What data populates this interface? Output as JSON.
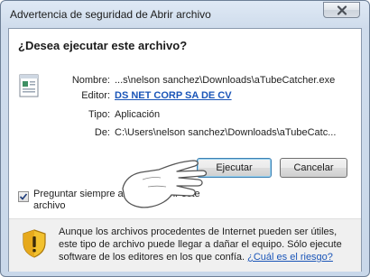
{
  "window": {
    "title": "Advertencia de seguridad de Abrir archivo"
  },
  "dialog": {
    "question": "¿Desea ejecutar este archivo?",
    "fields": [
      {
        "label": "Nombre:",
        "value": "...s\\nelson sanchez\\Downloads\\aTubeCatcher.exe"
      },
      {
        "label": "Editor:",
        "value": "DS NET CORP SA DE CV"
      },
      {
        "label": "Tipo:",
        "value": "Aplicación"
      },
      {
        "label": "De:",
        "value": "C:\\Users\\nelson sanchez\\Downloads\\aTubeCatc..."
      }
    ],
    "run_button": "Ejecutar",
    "cancel_button": "Cancelar",
    "checkbox_label": "Preguntar siempre antes de abrir este archivo",
    "checkbox_checked": true,
    "warning_text": "Aunque los archivos procedentes de Internet pueden ser útiles, este tipo de archivo puede llegar a dañar el equipo. Sólo ejecute software de los editores en los que confía.",
    "warning_link": "¿Cuál es el riesgo?"
  },
  "icons": {
    "close": "close-icon",
    "file": "application-file-icon",
    "shield": "security-warning-shield-icon",
    "cursor": "hand-pointer-cursor-icon"
  },
  "colors": {
    "link": "#1a55b8",
    "shield_yellow": "#f2c12e",
    "default_button_border": "#3c7fb1"
  }
}
